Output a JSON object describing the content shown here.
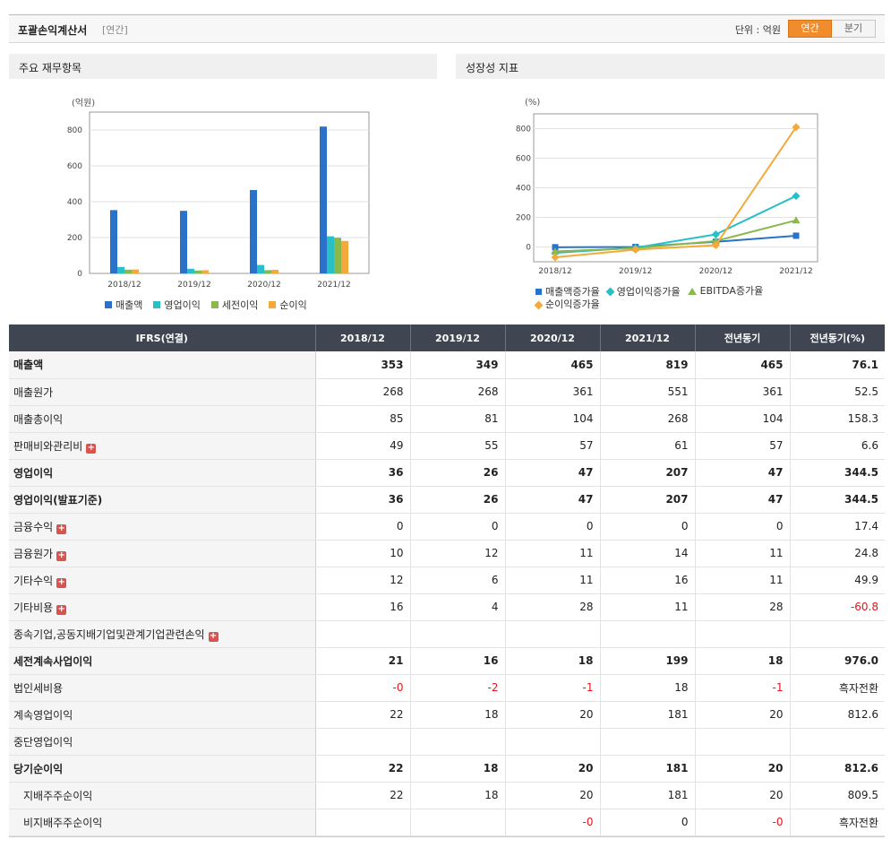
{
  "header": {
    "title": "포괄손익계산서",
    "subtitle": "[연간]",
    "unit_label": "단위 : 억원",
    "toggle_annual": "연간",
    "toggle_quarter": "분기"
  },
  "panels": {
    "left_title": "주요 재무항목",
    "right_title": "성장성 지표"
  },
  "colors": {
    "accent": "#f08c2b",
    "table_header": "#3f4652",
    "negative": "#e3141d",
    "bar_series": [
      "#2a72c9",
      "#29bfc6",
      "#89b84c",
      "#f4a93a"
    ],
    "line_series": [
      "#2a72c9",
      "#29bfc6",
      "#89b84c",
      "#f4a93a"
    ]
  },
  "chart_data": [
    {
      "type": "bar",
      "title": "주요 재무항목",
      "ylabel": "(억원)",
      "categories": [
        "2018/12",
        "2019/12",
        "2020/12",
        "2021/12"
      ],
      "ylim": [
        0,
        900
      ],
      "yticks": [
        0,
        200,
        400,
        600,
        800
      ],
      "grid": true,
      "legend": "bottom",
      "series": [
        {
          "name": "매출액",
          "values": [
            353,
            349,
            465,
            819
          ]
        },
        {
          "name": "영업이익",
          "values": [
            36,
            26,
            47,
            207
          ]
        },
        {
          "name": "세전이익",
          "values": [
            21,
            16,
            18,
            199
          ]
        },
        {
          "name": "순이익",
          "values": [
            22,
            18,
            20,
            181
          ]
        }
      ]
    },
    {
      "type": "line",
      "title": "성장성 지표",
      "ylabel": "(%)",
      "categories": [
        "2018/12",
        "2019/12",
        "2020/12",
        "2021/12"
      ],
      "ylim": [
        -100,
        900
      ],
      "yticks": [
        0,
        200,
        400,
        600,
        800
      ],
      "grid": true,
      "legend": "bottom",
      "series": [
        {
          "name": "매출액증가율",
          "values": [
            -2,
            0,
            35,
            76
          ]
        },
        {
          "name": "영업이익증가율",
          "values": [
            -40,
            -5,
            85,
            345
          ]
        },
        {
          "name": "EBITDA증가율",
          "values": [
            -30,
            -8,
            40,
            180
          ]
        },
        {
          "name": "순이익증가율",
          "values": [
            -70,
            -18,
            12,
            810
          ]
        }
      ]
    }
  ],
  "table": {
    "headers": [
      "IFRS(연결)",
      "2018/12",
      "2019/12",
      "2020/12",
      "2021/12",
      "전년동기",
      "전년동기(%)"
    ],
    "rows": [
      {
        "label": "매출액",
        "values": [
          "353",
          "349",
          "465",
          "819",
          "465",
          "76.1"
        ]
      },
      {
        "label": "매출원가",
        "values": [
          "268",
          "268",
          "361",
          "551",
          "361",
          "52.5"
        ]
      },
      {
        "label": "매출총이익",
        "values": [
          "85",
          "81",
          "104",
          "268",
          "104",
          "158.3"
        ]
      },
      {
        "label": "판매비와관리비",
        "values": [
          "49",
          "55",
          "57",
          "61",
          "57",
          "6.6"
        ]
      },
      {
        "label": "영업이익",
        "values": [
          "36",
          "26",
          "47",
          "207",
          "47",
          "344.5"
        ]
      },
      {
        "label": "영업이익(발표기준)",
        "values": [
          "36",
          "26",
          "47",
          "207",
          "47",
          "344.5"
        ]
      },
      {
        "label": "금융수익",
        "values": [
          "0",
          "0",
          "0",
          "0",
          "0",
          "17.4"
        ]
      },
      {
        "label": "금융원가",
        "values": [
          "10",
          "12",
          "11",
          "14",
          "11",
          "24.8"
        ]
      },
      {
        "label": "기타수익",
        "values": [
          "12",
          "6",
          "11",
          "16",
          "11",
          "49.9"
        ]
      },
      {
        "label": "기타비용",
        "values": [
          "16",
          "4",
          "28",
          "11",
          "28",
          "-60.8"
        ]
      },
      {
        "label": "종속기업,공동지배기업및관계기업관련손익",
        "values": [
          "",
          "",
          "",
          "",
          "",
          ""
        ]
      },
      {
        "label": "세전계속사업이익",
        "values": [
          "21",
          "16",
          "18",
          "199",
          "18",
          "976.0"
        ]
      },
      {
        "label": "법인세비용",
        "values": [
          "-0",
          "-2",
          "-1",
          "18",
          "-1",
          "흑자전환"
        ]
      },
      {
        "label": "계속영업이익",
        "values": [
          "22",
          "18",
          "20",
          "181",
          "20",
          "812.6"
        ]
      },
      {
        "label": "중단영업이익",
        "values": [
          "",
          "",
          "",
          "",
          "",
          ""
        ]
      },
      {
        "label": "당기순이익",
        "values": [
          "22",
          "18",
          "20",
          "181",
          "20",
          "812.6"
        ]
      },
      {
        "label": "지배주주순이익",
        "values": [
          "22",
          "18",
          "20",
          "181",
          "20",
          "809.5"
        ]
      },
      {
        "label": "비지배주주순이익",
        "values": [
          "",
          "",
          "-0",
          "0",
          "-0",
          "흑자전환"
        ]
      }
    ]
  }
}
